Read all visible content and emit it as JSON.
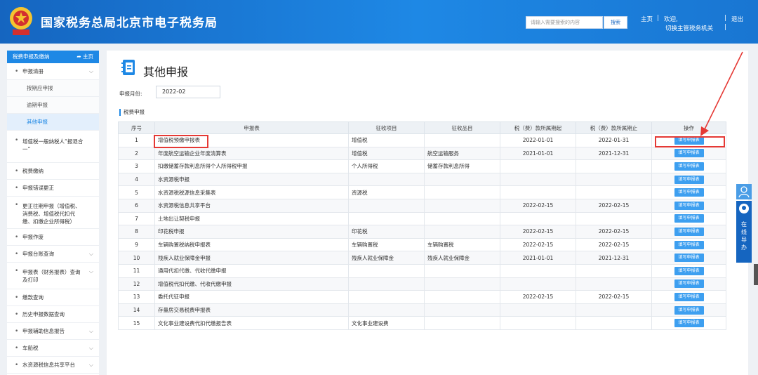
{
  "header": {
    "site_title": "国家税务总局北京市电子税务局",
    "search_placeholder": "请输入需要搜索的内容",
    "search_button": "搜索",
    "home_link": "主页",
    "welcome": "欢迎,",
    "separator1": "|",
    "separator2": "|",
    "logout": "退出",
    "switch_tax_office": "切换主管税务机关",
    "separator3": "|"
  },
  "sidebar": {
    "head_title": "税费申报及缴纳",
    "home_link": "主页",
    "items": [
      {
        "label": "申报清册",
        "expandable": true,
        "children": [
          "按期应申报",
          "逾期申报",
          "其他申报"
        ],
        "active_child": 2
      },
      {
        "label": "增值税一般纳税人“报退合一”"
      },
      {
        "label": "税费缴纳"
      },
      {
        "label": "申报错误更正"
      },
      {
        "label": "更正往期申报（增值税、消费税、增值税代扣代缴、扣缴企业所得税）"
      },
      {
        "label": "申报作废"
      },
      {
        "label": "申报台账查询",
        "expandable": true
      },
      {
        "label": "申报表（财务报表）查询及打印",
        "expandable": true
      },
      {
        "label": "缴款查询"
      },
      {
        "label": "历史申报数据查询"
      },
      {
        "label": "申报辅助信息报告",
        "expandable": true
      },
      {
        "label": "车船税",
        "expandable": true
      },
      {
        "label": "水资源税信息共享平台",
        "expandable": true
      }
    ]
  },
  "main": {
    "page_title": "其他申报",
    "month_label": "申报月份:",
    "month_value": "2022-02",
    "section_title": "税费申报",
    "columns": [
      "序号",
      "申报表",
      "征收项目",
      "征收品目",
      "税（费）款所属期起",
      "税（费）款所属期止",
      "操作"
    ],
    "action_label": "填写申报表",
    "rows": [
      [
        "1",
        "增值税预缴申报表",
        "增值税",
        "",
        "2022-01-01",
        "2022-01-31"
      ],
      [
        "2",
        "年度航空运输企业年度清算表",
        "增值税",
        "航空运输服务",
        "2021-01-01",
        "2021-12-31"
      ],
      [
        "3",
        "扣缴储蓄存款利息所得个人所得税申报",
        "个人所得税",
        "储蓄存款利息所得",
        "",
        ""
      ],
      [
        "4",
        "水资源税申报",
        "",
        "",
        "",
        ""
      ],
      [
        "5",
        "水资源税税源信息采集表",
        "资源税",
        "",
        "",
        ""
      ],
      [
        "6",
        "水资源税信息共享平台",
        "",
        "",
        "2022-02-15",
        "2022-02-15"
      ],
      [
        "7",
        "土地出让契税申报",
        "",
        "",
        "",
        ""
      ],
      [
        "8",
        "印花税申报",
        "印花税",
        "",
        "2022-02-15",
        "2022-02-15"
      ],
      [
        "9",
        "车辆购置税纳税申报表",
        "车辆购置税",
        "车辆购置税",
        "2022-02-15",
        "2022-02-15"
      ],
      [
        "10",
        "残疾人就业保障金申报",
        "残疾人就业保障金",
        "残疾人就业保障金",
        "2021-01-01",
        "2021-12-31"
      ],
      [
        "11",
        "通用代扣代缴、代收代缴申报",
        "",
        "",
        "",
        ""
      ],
      [
        "12",
        "增值税代扣代缴、代收代缴申报",
        "",
        "",
        "",
        ""
      ],
      [
        "13",
        "委托代征申报",
        "",
        "",
        "2022-02-15",
        "2022-02-15"
      ],
      [
        "14",
        "存量房交易税费申报表",
        "",
        "",
        "",
        ""
      ],
      [
        "15",
        "文化事业建设费代扣代缴报告表",
        "文化事业建设费",
        "",
        "",
        ""
      ]
    ]
  },
  "float_widget": {
    "label": "在线导办"
  },
  "colors": {
    "header_blue": "#1e88e5",
    "annotation_red": "#e53935",
    "button_blue": "#3d9ff0"
  }
}
